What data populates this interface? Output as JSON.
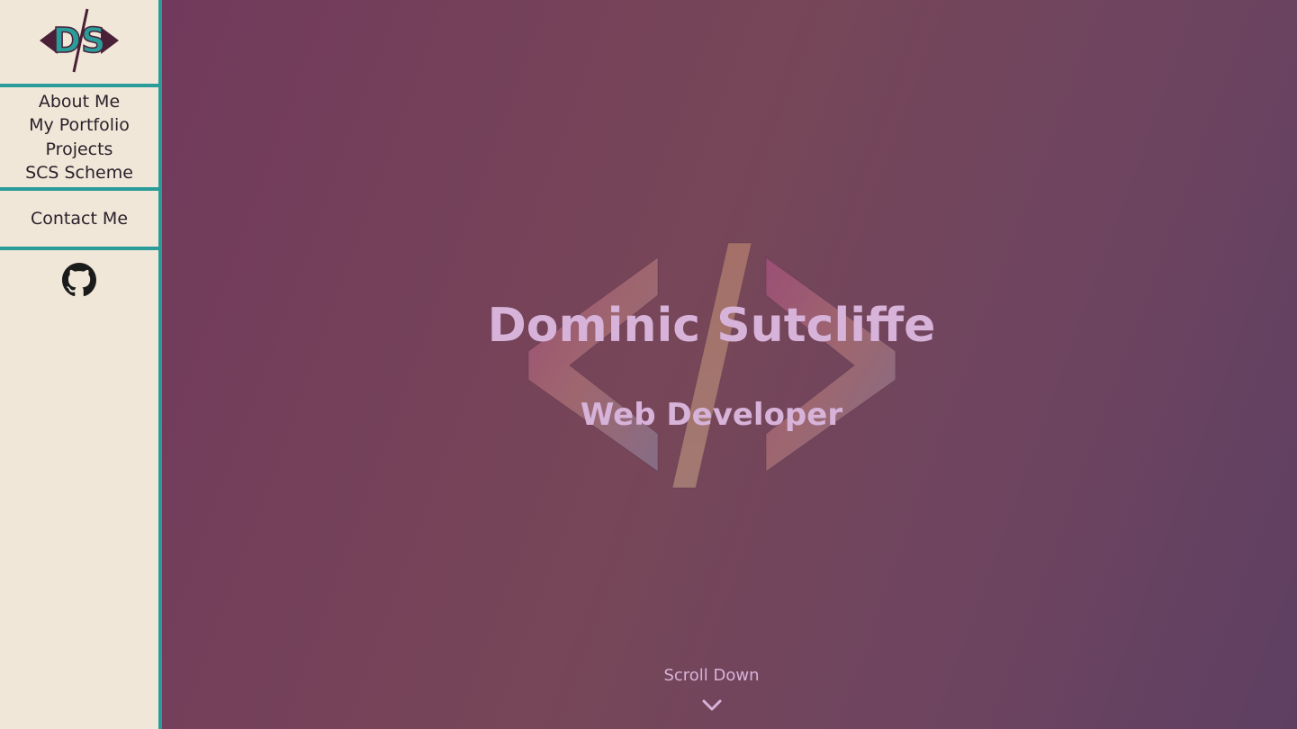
{
  "sidebar": {
    "logo_text": "DS",
    "nav": [
      {
        "label": "About Me"
      },
      {
        "label": "My Portfolio"
      },
      {
        "label": "Projects"
      },
      {
        "label": "SCS Scheme"
      }
    ],
    "contact_label": "Contact Me",
    "social_icon": "github-icon"
  },
  "hero": {
    "name": "Dominic Sutcliffe",
    "role": "Web Developer",
    "emblem_icon": "code-brackets-icon",
    "scroll_label": "Scroll Down",
    "scroll_icon": "chevron-down-icon"
  },
  "colors": {
    "sidebar_bg": "#f0e7d8",
    "accent": "#2a9d9a",
    "hero_text": "#d7b3d9",
    "hero_bg_start": "#713a5c",
    "hero_bg_end": "#5e3f62"
  }
}
